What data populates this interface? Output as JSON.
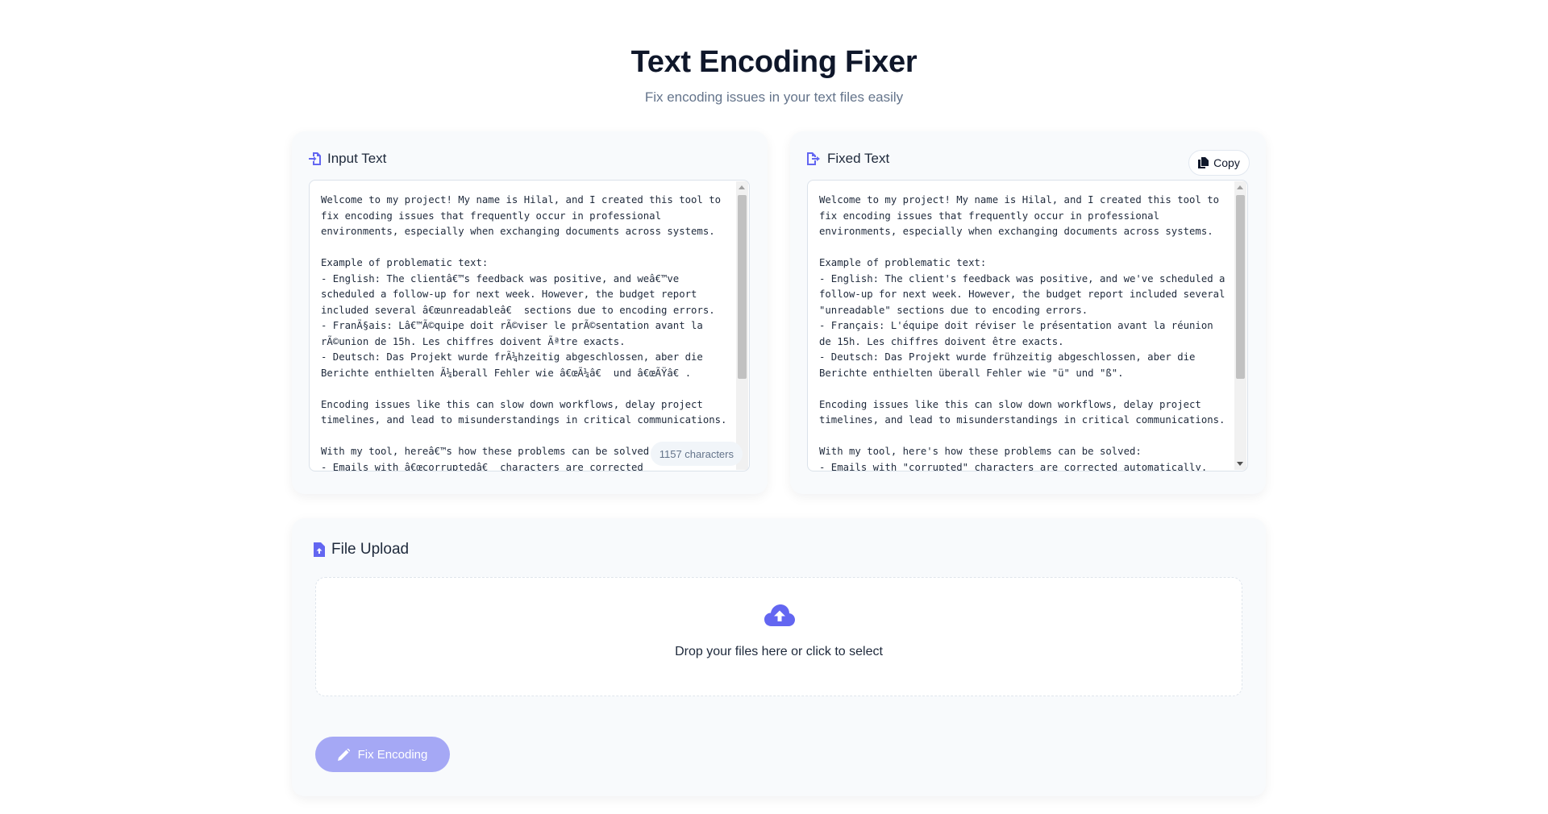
{
  "header": {
    "title": "Text Encoding Fixer",
    "subtitle": "Fix encoding issues in your text files easily"
  },
  "input_panel": {
    "title": "Input Text",
    "icon": "file-import-icon",
    "text": "Welcome to my project! My name is Hilal, and I created this tool to fix encoding issues that frequently occur in professional environments, especially when exchanging documents across systems.\n\nExample of problematic text:\n- English: The clientâ€™s feedback was positive, and weâ€™ve scheduled a follow-up for next week. However, the budget report included several â€œunreadableâ€ sections due to encoding errors.\n- FranÃ§ais: Lâ€™Ã©quipe doit rÃ©viser le prÃ©sentation avant la rÃ©union de 15h. Les chiffres doivent Ãªtre exacts.\n- Deutsch: Das Projekt wurde frÃ¼hzeitig abgeschlossen, aber die Berichte enthielten Ã¼berall Fehler wie â€œÃ¼â€ und â€œÃŸâ€.\n\nEncoding issues like this can slow down workflows, delay project timelines, and lead to misunderstandings in critical communications.\n\nWith my tool, hereâ€™s how these problems can be solved:\n- Emails with â€œcorruptedâ€ characters are corrected automatically.",
    "char_count": "1157 characters"
  },
  "fixed_panel": {
    "title": "Fixed Text",
    "icon": "file-export-icon",
    "copy_label": "Copy",
    "copy_icon": "copy-icon",
    "text": "Welcome to my project! My name is Hilal, and I created this tool to fix encoding issues that frequently occur in professional environments, especially when exchanging documents across systems.\n\nExample of problematic text:\n- English: The client's feedback was positive, and we've scheduled a follow-up for next week. However, the budget report included several \"unreadable\" sections due to encoding errors.\n- Français: L'équipe doit réviser le présentation avant la réunion de 15h. Les chiffres doivent être exacts.\n- Deutsch: Das Projekt wurde frühzeitig abgeschlossen, aber die Berichte enthielten überall Fehler wie \"ü\" und \"ß\".\n\nEncoding issues like this can slow down workflows, delay project timelines, and lead to misunderstandings in critical communications.\n\nWith my tool, here's how these problems can be solved:\n- Emails with \"corrupted\" characters are corrected automatically."
  },
  "upload": {
    "title": "File Upload",
    "icon": "file-upload-icon",
    "drop_text": "Drop your files here or click to select",
    "drop_icon": "cloud-upload-icon",
    "button_label": "Fix Encoding",
    "button_icon": "pencil-icon"
  },
  "colors": {
    "accent": "#6366f1",
    "button_disabled": "#a5a8f5"
  }
}
